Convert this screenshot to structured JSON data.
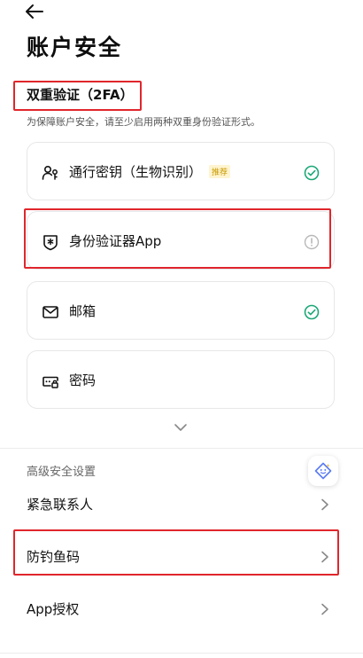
{
  "page": {
    "title": "账户安全"
  },
  "two_factor": {
    "title": "双重验证（2FA）",
    "description": "为保障账户安全，请至少启用两种双重身份验证形式。",
    "methods": [
      {
        "label": "通行密钥（生物识别）",
        "tag": "推荐",
        "status": "enabled"
      },
      {
        "label": "身份验证器App",
        "status": "warning"
      },
      {
        "label": "邮箱",
        "status": "enabled"
      },
      {
        "label": "密码",
        "status": "none"
      }
    ]
  },
  "advanced": {
    "title": "高级安全设置",
    "items": [
      {
        "label": "紧急联系人"
      },
      {
        "label": "防钓鱼码"
      },
      {
        "label": "App授权"
      }
    ]
  },
  "colors": {
    "success": "#1aa876",
    "warning": "#b8b8b8",
    "highlight": "#e0262c",
    "assistant": "#5b7bf5"
  }
}
